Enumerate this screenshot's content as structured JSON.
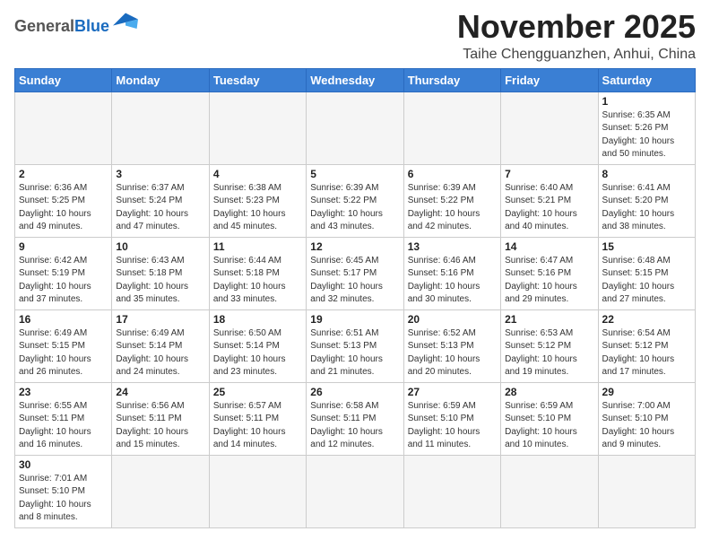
{
  "header": {
    "logo_general": "General",
    "logo_blue": "Blue",
    "month_title": "November 2025",
    "location": "Taihe Chengguanzhen, Anhui, China"
  },
  "days_of_week": [
    "Sunday",
    "Monday",
    "Tuesday",
    "Wednesday",
    "Thursday",
    "Friday",
    "Saturday"
  ],
  "weeks": [
    [
      {
        "day": "",
        "info": ""
      },
      {
        "day": "",
        "info": ""
      },
      {
        "day": "",
        "info": ""
      },
      {
        "day": "",
        "info": ""
      },
      {
        "day": "",
        "info": ""
      },
      {
        "day": "",
        "info": ""
      },
      {
        "day": "1",
        "info": "Sunrise: 6:35 AM\nSunset: 5:26 PM\nDaylight: 10 hours and 50 minutes."
      }
    ],
    [
      {
        "day": "2",
        "info": "Sunrise: 6:36 AM\nSunset: 5:25 PM\nDaylight: 10 hours and 49 minutes."
      },
      {
        "day": "3",
        "info": "Sunrise: 6:37 AM\nSunset: 5:24 PM\nDaylight: 10 hours and 47 minutes."
      },
      {
        "day": "4",
        "info": "Sunrise: 6:38 AM\nSunset: 5:23 PM\nDaylight: 10 hours and 45 minutes."
      },
      {
        "day": "5",
        "info": "Sunrise: 6:39 AM\nSunset: 5:22 PM\nDaylight: 10 hours and 43 minutes."
      },
      {
        "day": "6",
        "info": "Sunrise: 6:39 AM\nSunset: 5:22 PM\nDaylight: 10 hours and 42 minutes."
      },
      {
        "day": "7",
        "info": "Sunrise: 6:40 AM\nSunset: 5:21 PM\nDaylight: 10 hours and 40 minutes."
      },
      {
        "day": "8",
        "info": "Sunrise: 6:41 AM\nSunset: 5:20 PM\nDaylight: 10 hours and 38 minutes."
      }
    ],
    [
      {
        "day": "9",
        "info": "Sunrise: 6:42 AM\nSunset: 5:19 PM\nDaylight: 10 hours and 37 minutes."
      },
      {
        "day": "10",
        "info": "Sunrise: 6:43 AM\nSunset: 5:18 PM\nDaylight: 10 hours and 35 minutes."
      },
      {
        "day": "11",
        "info": "Sunrise: 6:44 AM\nSunset: 5:18 PM\nDaylight: 10 hours and 33 minutes."
      },
      {
        "day": "12",
        "info": "Sunrise: 6:45 AM\nSunset: 5:17 PM\nDaylight: 10 hours and 32 minutes."
      },
      {
        "day": "13",
        "info": "Sunrise: 6:46 AM\nSunset: 5:16 PM\nDaylight: 10 hours and 30 minutes."
      },
      {
        "day": "14",
        "info": "Sunrise: 6:47 AM\nSunset: 5:16 PM\nDaylight: 10 hours and 29 minutes."
      },
      {
        "day": "15",
        "info": "Sunrise: 6:48 AM\nSunset: 5:15 PM\nDaylight: 10 hours and 27 minutes."
      }
    ],
    [
      {
        "day": "16",
        "info": "Sunrise: 6:49 AM\nSunset: 5:15 PM\nDaylight: 10 hours and 26 minutes."
      },
      {
        "day": "17",
        "info": "Sunrise: 6:49 AM\nSunset: 5:14 PM\nDaylight: 10 hours and 24 minutes."
      },
      {
        "day": "18",
        "info": "Sunrise: 6:50 AM\nSunset: 5:14 PM\nDaylight: 10 hours and 23 minutes."
      },
      {
        "day": "19",
        "info": "Sunrise: 6:51 AM\nSunset: 5:13 PM\nDaylight: 10 hours and 21 minutes."
      },
      {
        "day": "20",
        "info": "Sunrise: 6:52 AM\nSunset: 5:13 PM\nDaylight: 10 hours and 20 minutes."
      },
      {
        "day": "21",
        "info": "Sunrise: 6:53 AM\nSunset: 5:12 PM\nDaylight: 10 hours and 19 minutes."
      },
      {
        "day": "22",
        "info": "Sunrise: 6:54 AM\nSunset: 5:12 PM\nDaylight: 10 hours and 17 minutes."
      }
    ],
    [
      {
        "day": "23",
        "info": "Sunrise: 6:55 AM\nSunset: 5:11 PM\nDaylight: 10 hours and 16 minutes."
      },
      {
        "day": "24",
        "info": "Sunrise: 6:56 AM\nSunset: 5:11 PM\nDaylight: 10 hours and 15 minutes."
      },
      {
        "day": "25",
        "info": "Sunrise: 6:57 AM\nSunset: 5:11 PM\nDaylight: 10 hours and 14 minutes."
      },
      {
        "day": "26",
        "info": "Sunrise: 6:58 AM\nSunset: 5:11 PM\nDaylight: 10 hours and 12 minutes."
      },
      {
        "day": "27",
        "info": "Sunrise: 6:59 AM\nSunset: 5:10 PM\nDaylight: 10 hours and 11 minutes."
      },
      {
        "day": "28",
        "info": "Sunrise: 6:59 AM\nSunset: 5:10 PM\nDaylight: 10 hours and 10 minutes."
      },
      {
        "day": "29",
        "info": "Sunrise: 7:00 AM\nSunset: 5:10 PM\nDaylight: 10 hours and 9 minutes."
      }
    ],
    [
      {
        "day": "30",
        "info": "Sunrise: 7:01 AM\nSunset: 5:10 PM\nDaylight: 10 hours and 8 minutes."
      },
      {
        "day": "",
        "info": ""
      },
      {
        "day": "",
        "info": ""
      },
      {
        "day": "",
        "info": ""
      },
      {
        "day": "",
        "info": ""
      },
      {
        "day": "",
        "info": ""
      },
      {
        "day": "",
        "info": ""
      }
    ]
  ]
}
